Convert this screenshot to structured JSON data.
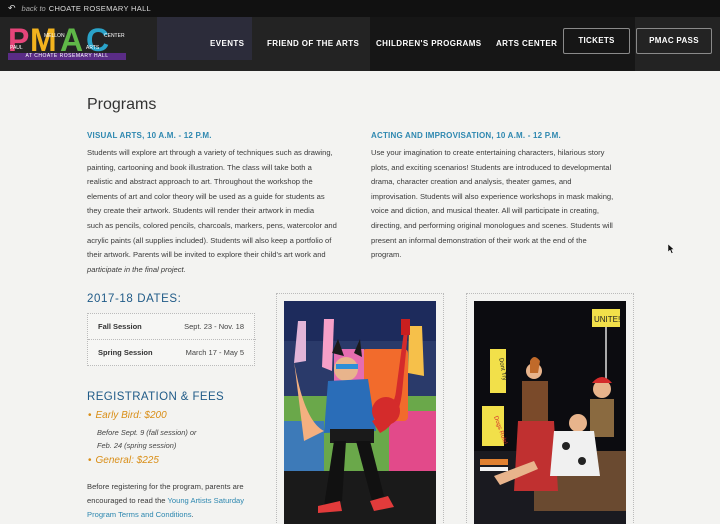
{
  "topbar": {
    "back_prefix": "back to",
    "back_name": "CHOATE ROSEMARY HALL"
  },
  "logo": {
    "letters": [
      "P",
      "M",
      "A",
      "C"
    ],
    "small_words": [
      "PAUL",
      "MELLON",
      "ARTS",
      "CENTER"
    ],
    "tagline": "AT CHOATE ROSEMARY HALL"
  },
  "nav": {
    "items": [
      "EVENTS",
      "FRIEND OF THE ARTS",
      "CHILDREN'S PROGRAMS",
      "ARTS CENTER"
    ],
    "tickets": "TICKETS",
    "pmac_pass": "PMAC PASS"
  },
  "page": {
    "title": "Programs"
  },
  "visual_arts": {
    "heading": "VISUAL ARTS, 10 A.M. - 12 P.M.",
    "lines": [
      "Students will explore art through a variety of techniques such as drawing,",
      "painting, cartooning and book illustration. The class will take both a",
      "realistic and abstract approach to art. Throughout the workshop the",
      "elements of art and color theory will be used as a guide for students as",
      "they create their artwork. Students will render their artwork in media",
      "such as pencils, colored pencils, charcoals, markers, pens, watercolor and",
      "acrylic paints (all supplies included). Students will also keep a portfolio of",
      "their artwork. Parents will be invited to explore their child's art work and",
      "participate in the final project."
    ]
  },
  "acting": {
    "heading": "ACTING AND IMPROVISATION, 10 A.M. - 12 P.M.",
    "lines": [
      "Use your imagination to create entertaining characters, hilarious story",
      "plots, and exciting scenarios! Students are introduced to developmental",
      "drama, character creation and analysis, theater games, and",
      "improvisation. Students will also experience workshops in mask making,",
      "voice and diction, and musical theater. All will participate in creating,",
      "directing, and performing original monologues and scenes. Students will",
      "present an informal demonstration of their work at the end of the",
      "program."
    ]
  },
  "dates": {
    "title": "2017-18 DATES:",
    "rows": [
      {
        "label": "Fall Session",
        "value": "Sept. 23 - Nov. 18"
      },
      {
        "label": "Spring Session",
        "value": "March 17 - May 5"
      }
    ]
  },
  "registration": {
    "title": "REGISTRATION & FEES",
    "early_bird": "Early Bird: $200",
    "early_note_1": "Before Sept. 9 (fall session) or",
    "early_note_2": "Feb. 24 (spring session)",
    "general": "General: $225",
    "para_1": "Before registering for the program, parents are",
    "para_2": "encouraged to read the",
    "link_1": "Young Artists Saturday",
    "link_2": "Program Terms and Conditions",
    "para_end": "."
  },
  "photo_signs": {
    "sign_1": "Dont Try",
    "sign_2": "Dogs Rule!",
    "sign_3": "UNITE!"
  },
  "colors": {
    "accent_blue": "#2e88b0",
    "heading_blue": "#205b88",
    "fee_orange": "#d98e17",
    "nav_bg": "#232323"
  }
}
